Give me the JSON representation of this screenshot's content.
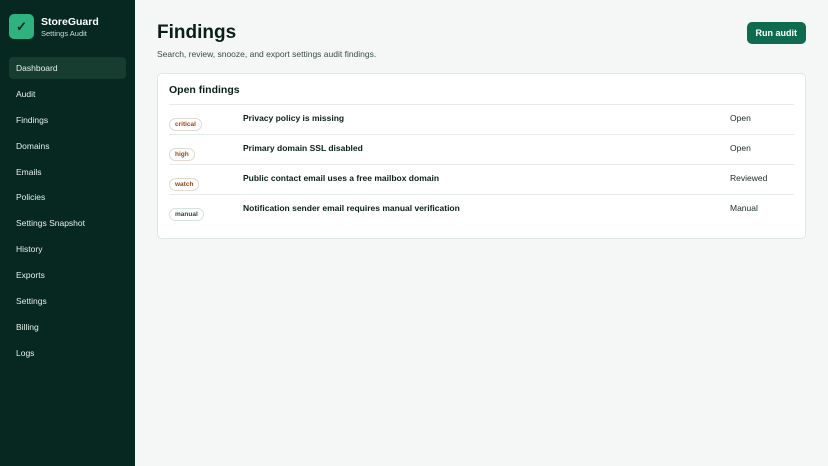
{
  "brand": {
    "name": "StoreGuard",
    "subtitle": "Settings Audit",
    "logo_icon": "✓"
  },
  "sidebar": {
    "items": [
      {
        "label": "Dashboard",
        "active": true
      },
      {
        "label": "Audit"
      },
      {
        "label": "Findings"
      },
      {
        "label": "Domains"
      },
      {
        "label": "Emails"
      },
      {
        "label": "Policies"
      },
      {
        "label": "Settings Snapshot"
      },
      {
        "label": "History"
      },
      {
        "label": "Exports"
      },
      {
        "label": "Settings"
      },
      {
        "label": "Billing"
      },
      {
        "label": "Logs"
      }
    ]
  },
  "header": {
    "title": "Findings",
    "subtitle": "Search, review, snooze, and export settings audit findings.",
    "run_button": "Run audit"
  },
  "card": {
    "title": "Open findings",
    "findings": [
      {
        "severity": "critical",
        "title": "Privacy policy is missing",
        "status": "Open"
      },
      {
        "severity": "high",
        "title": "Primary domain SSL disabled",
        "status": "Open"
      },
      {
        "severity": "watch",
        "title": "Public contact email uses a free mailbox domain",
        "status": "Reviewed"
      },
      {
        "severity": "manual",
        "title": "Notification sender email requires manual verification",
        "status": "Manual"
      }
    ]
  },
  "colors": {
    "sidebar_bg": "#062820",
    "accent": "#0f6b4f",
    "logo_bg": "#2fb27f"
  }
}
